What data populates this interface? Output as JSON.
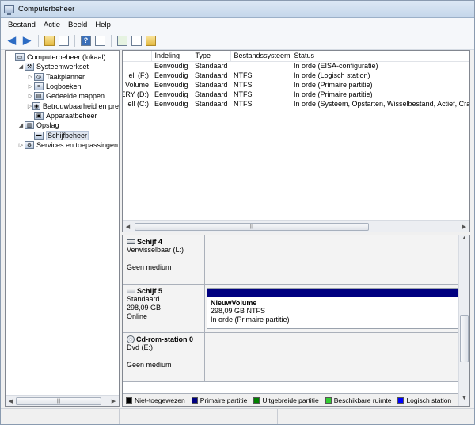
{
  "window": {
    "title": "Computerbeheer"
  },
  "menu": [
    "Bestand",
    "Actie",
    "Beeld",
    "Help"
  ],
  "tree": [
    {
      "label": "Computerbeheer (lokaal)",
      "level": 0,
      "expander": "",
      "icon": "computer-icon",
      "selected": false
    },
    {
      "label": "Systeemwerkset",
      "level": 1,
      "expander": "◢",
      "icon": "tools-icon",
      "selected": false
    },
    {
      "label": "Taakplanner",
      "level": 2,
      "expander": "▷",
      "icon": "clock-icon",
      "selected": false
    },
    {
      "label": "Logboeken",
      "level": 2,
      "expander": "▷",
      "icon": "log-icon",
      "selected": false
    },
    {
      "label": "Gedeelde mappen",
      "level": 2,
      "expander": "▷",
      "icon": "shared-folder-icon",
      "selected": false
    },
    {
      "label": "Betrouwbaarheid en pre",
      "level": 2,
      "expander": "▷",
      "icon": "reliability-icon",
      "selected": false
    },
    {
      "label": "Apparaatbeheer",
      "level": 2,
      "expander": "",
      "icon": "device-manager-icon",
      "selected": false
    },
    {
      "label": "Opslag",
      "level": 1,
      "expander": "◢",
      "icon": "storage-icon",
      "selected": false
    },
    {
      "label": "Schijfbeheer",
      "level": 2,
      "expander": "",
      "icon": "disk-management-icon",
      "selected": true
    },
    {
      "label": "Services en toepassingen",
      "level": 1,
      "expander": "▷",
      "icon": "services-icon",
      "selected": false
    }
  ],
  "table": {
    "headers": [
      "",
      "Indeling",
      "Type",
      "Bestandssysteem",
      "Status"
    ],
    "rows": [
      [
        "",
        "Eenvoudig",
        "Standaard",
        "",
        "In orde (EISA-configuratie)"
      ],
      [
        "ell (F:)",
        "Eenvoudig",
        "Standaard",
        "NTFS",
        "In orde (Logisch station)"
      ],
      [
        "Volume",
        "Eenvoudig",
        "Standaard",
        "NTFS",
        "In orde (Primaire partitie)"
      ],
      [
        "VERY (D:)",
        "Eenvoudig",
        "Standaard",
        "NTFS",
        "In orde (Primaire partitie)"
      ],
      [
        "ell (C:)",
        "Eenvoudig",
        "Standaard",
        "NTFS",
        "In orde (Systeem, Opstarten, Wisselbestand, Actief, Crashd"
      ]
    ]
  },
  "disks": [
    {
      "name": "Schijf 4",
      "icon": "disk-icon",
      "lines": [
        "Verwisselbaar (L:)",
        "",
        "Geen medium"
      ],
      "partition": null
    },
    {
      "name": "Schijf 5",
      "icon": "disk-icon",
      "lines": [
        "Standaard",
        "298,09 GB",
        "Online"
      ],
      "partition": {
        "name": "NieuwVolume",
        "size": "298,09 GB NTFS",
        "status": "In orde (Primaire partitie)",
        "color": "#000080"
      }
    },
    {
      "name": "Cd-rom-station 0",
      "icon": "cd-icon",
      "lines": [
        "Dvd (E:)",
        "",
        "Geen medium"
      ],
      "partition": null
    }
  ],
  "legend": [
    {
      "label": "Niet-toegewezen",
      "color": "#000000"
    },
    {
      "label": "Primaire partitie",
      "color": "#000080"
    },
    {
      "label": "Uitgebreide partitie",
      "color": "#008000"
    },
    {
      "label": "Beschikbare ruimte",
      "color": "#33cc33"
    },
    {
      "label": "Logisch station",
      "color": "#0000ff"
    }
  ],
  "scroll": {
    "thumb_grip": "|||"
  }
}
